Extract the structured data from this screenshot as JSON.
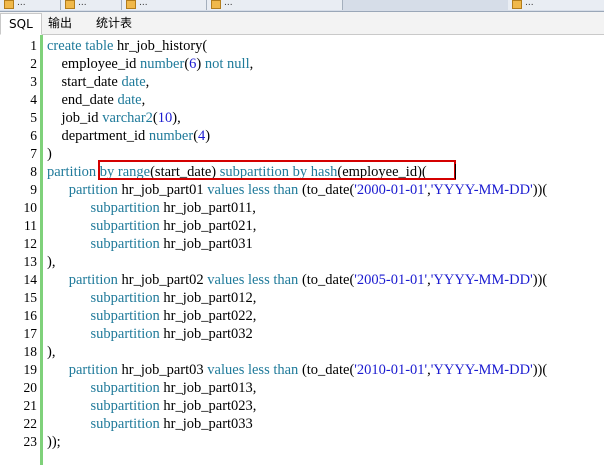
{
  "top_tabs": [
    "...",
    "...",
    "...",
    "...",
    "..."
  ],
  "tabs": [
    {
      "label": "SQL"
    },
    {
      "label": "输出"
    },
    {
      "label": "统计表"
    }
  ],
  "code_lines": [
    {
      "n": "1",
      "segs": [
        [
          "kw",
          "create table "
        ],
        [
          "plain",
          "hr_job_history("
        ]
      ]
    },
    {
      "n": "2",
      "segs": [
        [
          "plain",
          "    employee_id "
        ],
        [
          "kw",
          "number"
        ],
        [
          "plain",
          "("
        ],
        [
          "num",
          "6"
        ],
        [
          "plain",
          ") "
        ],
        [
          "kw",
          "not null"
        ],
        [
          "plain",
          ","
        ]
      ]
    },
    {
      "n": "3",
      "segs": [
        [
          "plain",
          "    start_date "
        ],
        [
          "kw",
          "date"
        ],
        [
          "plain",
          ","
        ]
      ]
    },
    {
      "n": "4",
      "segs": [
        [
          "plain",
          "    end_date "
        ],
        [
          "kw",
          "date"
        ],
        [
          "plain",
          ","
        ]
      ]
    },
    {
      "n": "5",
      "segs": [
        [
          "plain",
          "    job_id "
        ],
        [
          "kw",
          "varchar2"
        ],
        [
          "plain",
          "("
        ],
        [
          "num",
          "10"
        ],
        [
          "plain",
          "),"
        ]
      ]
    },
    {
      "n": "6",
      "segs": [
        [
          "plain",
          "    department_id "
        ],
        [
          "kw",
          "number"
        ],
        [
          "plain",
          "("
        ],
        [
          "num",
          "4"
        ],
        [
          "plain",
          ")"
        ]
      ]
    },
    {
      "n": "7",
      "segs": [
        [
          "plain",
          ")"
        ]
      ]
    },
    {
      "n": "8",
      "segs": [
        [
          "kw",
          "partition "
        ],
        [
          "kw",
          "by range"
        ],
        [
          "plain",
          "(start_date) "
        ],
        [
          "kw",
          "subpartition by hash"
        ],
        [
          "plain",
          "(employee_id)("
        ]
      ]
    },
    {
      "n": "9",
      "segs": [
        [
          "plain",
          "      "
        ],
        [
          "kw",
          "partition "
        ],
        [
          "plain",
          "hr_job_part01 "
        ],
        [
          "kw",
          "values less than "
        ],
        [
          "plain",
          "(to_date("
        ],
        [
          "str",
          "'2000-01-01'"
        ],
        [
          "plain",
          ","
        ],
        [
          "str",
          "'YYYY-MM-DD'"
        ],
        [
          "plain",
          "))("
        ]
      ]
    },
    {
      "n": "10",
      "segs": [
        [
          "plain",
          "            "
        ],
        [
          "kw",
          "subpartition "
        ],
        [
          "plain",
          "hr_job_part011,"
        ]
      ]
    },
    {
      "n": "11",
      "segs": [
        [
          "plain",
          "            "
        ],
        [
          "kw",
          "subpartition "
        ],
        [
          "plain",
          "hr_job_part021,"
        ]
      ]
    },
    {
      "n": "12",
      "segs": [
        [
          "plain",
          "            "
        ],
        [
          "kw",
          "subpartition "
        ],
        [
          "plain",
          "hr_job_part031"
        ]
      ]
    },
    {
      "n": "13",
      "segs": [
        [
          "plain",
          "),"
        ]
      ]
    },
    {
      "n": "14",
      "segs": [
        [
          "plain",
          "      "
        ],
        [
          "kw",
          "partition "
        ],
        [
          "plain",
          "hr_job_part02 "
        ],
        [
          "kw",
          "values less than "
        ],
        [
          "plain",
          "(to_date("
        ],
        [
          "str",
          "'2005-01-01'"
        ],
        [
          "plain",
          ","
        ],
        [
          "str",
          "'YYYY-MM-DD'"
        ],
        [
          "plain",
          "))("
        ]
      ]
    },
    {
      "n": "15",
      "segs": [
        [
          "plain",
          "            "
        ],
        [
          "kw",
          "subpartition "
        ],
        [
          "plain",
          "hr_job_part012,"
        ]
      ]
    },
    {
      "n": "16",
      "segs": [
        [
          "plain",
          "            "
        ],
        [
          "kw",
          "subpartition "
        ],
        [
          "plain",
          "hr_job_part022,"
        ]
      ]
    },
    {
      "n": "17",
      "segs": [
        [
          "plain",
          "            "
        ],
        [
          "kw",
          "subpartition "
        ],
        [
          "plain",
          "hr_job_part032"
        ]
      ]
    },
    {
      "n": "18",
      "segs": [
        [
          "plain",
          "),"
        ]
      ]
    },
    {
      "n": "19",
      "segs": [
        [
          "plain",
          "      "
        ],
        [
          "kw",
          "partition "
        ],
        [
          "plain",
          "hr_job_part03 "
        ],
        [
          "kw",
          "values less than "
        ],
        [
          "plain",
          "(to_date("
        ],
        [
          "str",
          "'2010-01-01'"
        ],
        [
          "plain",
          ","
        ],
        [
          "str",
          "'YYYY-MM-DD'"
        ],
        [
          "plain",
          "))("
        ]
      ]
    },
    {
      "n": "20",
      "segs": [
        [
          "plain",
          "            "
        ],
        [
          "kw",
          "subpartition "
        ],
        [
          "plain",
          "hr_job_part013,"
        ]
      ]
    },
    {
      "n": "21",
      "segs": [
        [
          "plain",
          "            "
        ],
        [
          "kw",
          "subpartition "
        ],
        [
          "plain",
          "hr_job_part023,"
        ]
      ]
    },
    {
      "n": "22",
      "segs": [
        [
          "plain",
          "            "
        ],
        [
          "kw",
          "subpartition "
        ],
        [
          "plain",
          "hr_job_part033"
        ]
      ]
    },
    {
      "n": "23",
      "segs": [
        [
          "plain",
          "));"
        ]
      ]
    }
  ],
  "colors": {
    "keyword": "#1f7a9a",
    "string": "#1a1ad0",
    "fold_bar": "#7fd17a",
    "highlight": "#d40000"
  }
}
